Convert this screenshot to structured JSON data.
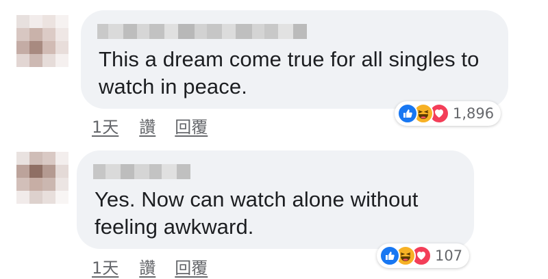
{
  "comments": [
    {
      "text": "This a dream come true for all singles to watch in peace.",
      "actions": {
        "time": "1天",
        "like": "讚",
        "reply": "回覆"
      },
      "reactions": {
        "icons": [
          "like-icon",
          "haha-icon",
          "love-icon"
        ],
        "count": "1,896"
      }
    },
    {
      "text": "Yes. Now can watch alone without feeling awkward.",
      "actions": {
        "time": "1天",
        "like": "讚",
        "reply": "回覆"
      },
      "reactions": {
        "icons": [
          "like-icon",
          "haha-icon",
          "love-icon"
        ],
        "count": "107"
      }
    }
  ],
  "colors": {
    "bubble": "#f0f2f5",
    "text": "#1c1e21",
    "meta": "#65676b",
    "like": "#1877f2",
    "haha": "#f7b125",
    "love": "#f33e58"
  }
}
